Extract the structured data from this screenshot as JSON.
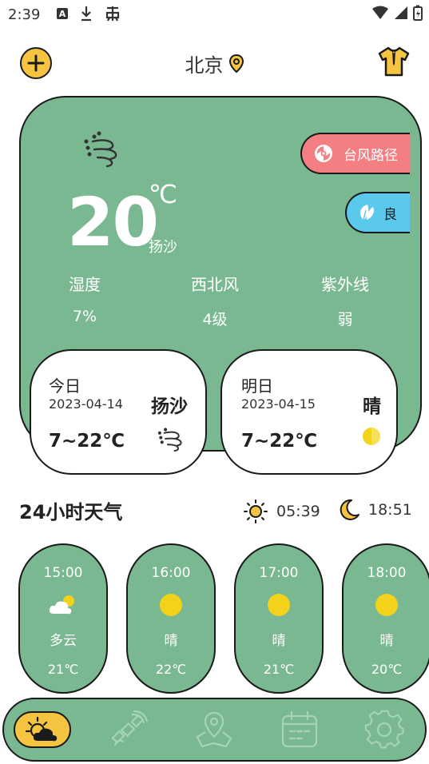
{
  "status_bar": {
    "time": "2:39"
  },
  "header": {
    "city": "北京"
  },
  "current": {
    "temperature": "20",
    "unit": "℃",
    "condition": "扬沙",
    "typhoon_label": "台风路径",
    "aqi_label": "良",
    "stats": [
      {
        "label": "湿度",
        "value": "7%"
      },
      {
        "label": "西北风",
        "value": "4级"
      },
      {
        "label": "紫外线",
        "value": "弱"
      }
    ]
  },
  "days": [
    {
      "name": "今日",
      "date": "2023-04-14",
      "condition": "扬沙",
      "range": "7~22℃",
      "icon": "wind-icon"
    },
    {
      "name": "明日",
      "date": "2023-04-15",
      "condition": "晴",
      "range": "7~22℃",
      "icon": "sun-icon"
    }
  ],
  "hourly_section": {
    "title": "24小时天气",
    "sunrise": "05:39",
    "sunset": "18:51"
  },
  "hourly": [
    {
      "time": "15:00",
      "condition": "多云",
      "temp": "21℃",
      "icon": "partly-cloudy-icon"
    },
    {
      "time": "16:00",
      "condition": "晴",
      "temp": "22℃",
      "icon": "sun-icon"
    },
    {
      "time": "17:00",
      "condition": "晴",
      "temp": "21℃",
      "icon": "sun-icon"
    },
    {
      "time": "18:00",
      "condition": "晴",
      "temp": "20℃",
      "icon": "sun-icon"
    }
  ],
  "bottom_nav": {
    "items": [
      "weather-icon",
      "satellite-icon",
      "map-icon",
      "calendar-icon",
      "settings-icon"
    ],
    "active_index": 0
  },
  "colors": {
    "card_green": "#7ab891",
    "accent_yellow": "#f5c542",
    "typhoon_red": "#f47f82",
    "aqi_blue": "#5bc8ee",
    "sun_yellow": "#f2d21a"
  }
}
